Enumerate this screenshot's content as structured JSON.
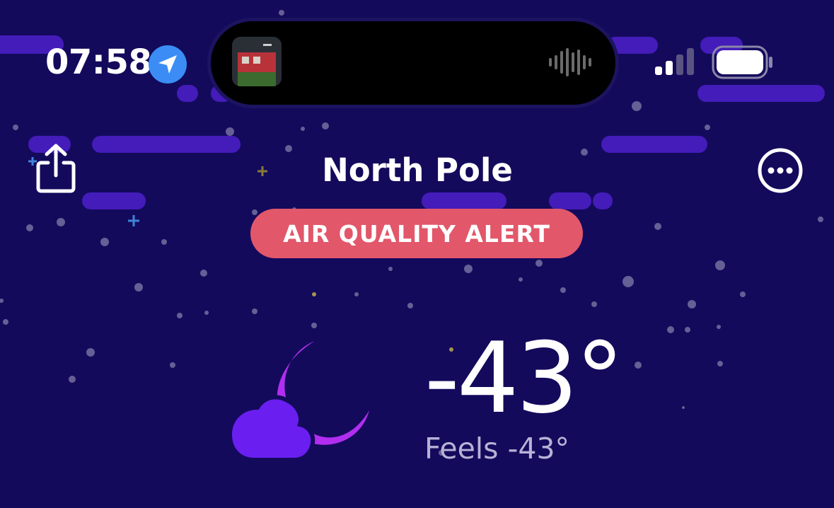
{
  "status_bar": {
    "time": "07:58",
    "icons": [
      "location-arrow-icon",
      "waveform-icon",
      "cellular-signal-icon",
      "battery-icon"
    ]
  },
  "header": {
    "city": "North Pole",
    "alert_label": "AIR QUALITY ALERT",
    "icons": [
      "share-icon",
      "more-options-icon"
    ]
  },
  "current": {
    "temperature": "-43°",
    "feels_prefix": "Feels",
    "feels_value": "-43°",
    "condition_icon": "moon-cloud-icon"
  },
  "colors": {
    "background": "#130a5c",
    "alert": "#e2576a",
    "location_badge": "#3b8df5",
    "moon": "#b12ef0",
    "cloud": "#6a1ff0",
    "streak": "#4a1ec4"
  }
}
